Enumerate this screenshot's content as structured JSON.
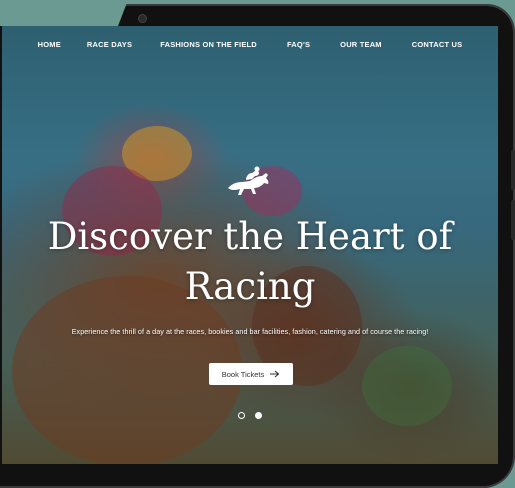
{
  "nav": {
    "items": [
      {
        "label": "HOME"
      },
      {
        "label": "RACE DAYS"
      },
      {
        "label": "FASHIONS ON THE FIELD"
      },
      {
        "label": "FAQ'S"
      },
      {
        "label": "OUR TEAM"
      },
      {
        "label": "CONTACT US"
      }
    ]
  },
  "hero": {
    "logo_icon": "horse-and-jockey-icon",
    "title_line1": "Discover the Heart of",
    "title_line2": "Racing",
    "subtitle": "Experience the thrill of a day at the races, bookies and bar facilities, fashion, catering and of course the racing!",
    "cta_label": "Book Tickets",
    "cta_icon": "arrow-right-icon"
  },
  "slider": {
    "slide_count": 2,
    "active_index": 0
  },
  "colors": {
    "background": "#6b9a93",
    "frame": "#111111",
    "button_bg": "#ffffff",
    "text": "#ffffff"
  }
}
